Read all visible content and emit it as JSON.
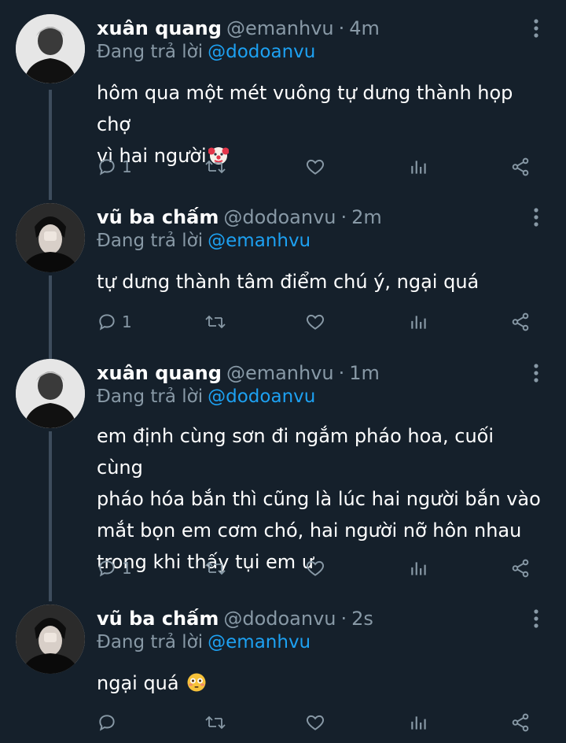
{
  "thread": [
    {
      "display_name": "xuân quang",
      "handle": "@emanhvu",
      "separator": "·",
      "time": "4m",
      "reply_prefix": "Đang trả lời",
      "reply_to": "@dodoanvu",
      "text": "hôm qua một mét vuông tự dưng thành họp chợ\nvì hai người",
      "emoji": "clown-face",
      "reply_count": "1",
      "avatar": "portrait-light"
    },
    {
      "display_name": "vũ ba chấm",
      "handle": "@dodoanvu",
      "separator": "·",
      "time": "2m",
      "reply_prefix": "Đang trả lời",
      "reply_to": "@emanhvu",
      "text": "tự dưng thành tâm điểm chú ý, ngại quá",
      "emoji": "",
      "reply_count": "1",
      "avatar": "portrait-dark"
    },
    {
      "display_name": "xuân quang",
      "handle": "@emanhvu",
      "separator": "·",
      "time": "1m",
      "reply_prefix": "Đang trả lời",
      "reply_to": "@dodoanvu",
      "text": "em định cùng sơn đi ngắm pháo hoa, cuối cùng\npháo hóa bắn thì cũng là lúc hai người bắn vào\nmắt bọn em cơm chó, hai người nỡ hôn nhau\ntrong khi thấy tụi em ư",
      "emoji": "",
      "reply_count": "1",
      "avatar": "portrait-light"
    },
    {
      "display_name": "vũ ba chấm",
      "handle": "@dodoanvu",
      "separator": "·",
      "time": "2s",
      "reply_prefix": "Đang trả lời",
      "reply_to": "@emanhvu",
      "text": "ngại quá ",
      "emoji": "flushed-face",
      "reply_count": "",
      "avatar": "portrait-dark"
    }
  ],
  "icons": {
    "reply": "reply-icon",
    "retweet": "retweet-icon",
    "like": "heart-icon",
    "views": "analytics-icon",
    "share": "share-icon",
    "more": "more-options-icon"
  },
  "colors": {
    "background": "#15202b",
    "text_primary": "#ffffff",
    "text_secondary": "#8899a6",
    "link": "#1da1f2",
    "thread_line": "#3d4c5c"
  }
}
